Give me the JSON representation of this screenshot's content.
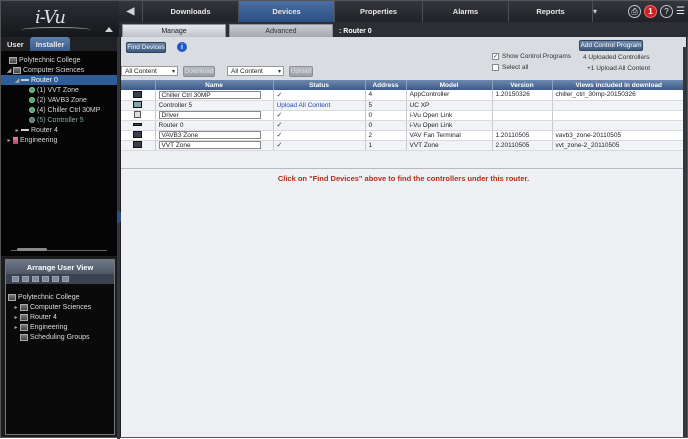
{
  "app": {
    "logo_text": "i-Vu"
  },
  "topnav": {
    "tabs": [
      {
        "label": "Downloads",
        "active": false
      },
      {
        "label": "Devices",
        "active": true
      },
      {
        "label": "Properties",
        "active": false
      },
      {
        "label": "Alarms",
        "active": false
      },
      {
        "label": "Reports",
        "active": false
      }
    ],
    "alarm_count": "1",
    "help_label": "?",
    "dropdown_glyph": "▾"
  },
  "subnav": {
    "tabs": [
      {
        "label": "Manage",
        "active": true
      },
      {
        "label": "Advanced",
        "active": false
      }
    ],
    "breadcrumb": ": Router 0"
  },
  "sidebar": {
    "tabs": [
      {
        "label": "User",
        "active": false
      },
      {
        "label": "Installer",
        "active": true
      }
    ],
    "tree": [
      {
        "label": "Polytechnic College",
        "icon": "building-icon"
      },
      {
        "label": "Computer Sciences",
        "icon": "building-icon"
      },
      {
        "label": "Router 0",
        "icon": "router-icon",
        "selected": true
      },
      {
        "label": "(1) VVT Zone",
        "icon": "controller-icon"
      },
      {
        "label": "(2) VAVB3 Zone",
        "icon": "controller-icon"
      },
      {
        "label": "(4) Chiller Ctrl 30MP",
        "icon": "controller-icon"
      },
      {
        "label": "(5) Controller 5",
        "icon": "controller-icon"
      },
      {
        "label": "Router 4",
        "icon": "router-icon"
      },
      {
        "label": "Engineering",
        "icon": "building-icon"
      }
    ]
  },
  "arrange_view": {
    "title": "Arrange User View",
    "items": [
      {
        "label": "Polytechnic College"
      },
      {
        "label": "Computer Sciences"
      },
      {
        "label": "Router 4"
      },
      {
        "label": "Engineering"
      },
      {
        "label": "Scheduling Groups"
      }
    ]
  },
  "toolbar": {
    "find_devices_label": "Find Devices",
    "info_label": "i",
    "content_select_1": "All Content",
    "download_label": "Download",
    "content_select_2": "All Content",
    "upload_label": "Upload",
    "show_control_programs": "Show Control Programs",
    "show_control_programs_checked": "✓",
    "select_all": "Select all",
    "add_control_program_label": "Add Control Program",
    "uploaded_controllers": "4  Uploaded Controllers",
    "upload_all_content": "+1 Upload All Content"
  },
  "table": {
    "columns": [
      "Name",
      "Status",
      "Address",
      "Model",
      "Version",
      "Views included in download"
    ],
    "rows": [
      {
        "icon": "controller-icon",
        "name": "Chiller Ctrl 30MP",
        "status": "✓",
        "address": "4",
        "model": "AppController",
        "version": "1.20150326",
        "views": "chiller_ctrl_30mp-20150326"
      },
      {
        "icon": "transmitter-icon",
        "name": "Controller 5",
        "status": "Upload All Content",
        "address": "5",
        "model": "UC XP",
        "version": "",
        "views": ""
      },
      {
        "icon": "driver-icon",
        "name": "Driver",
        "status": "✓",
        "address": "0",
        "model": "i-Vu Open Link",
        "version": "",
        "views": ""
      },
      {
        "icon": "router-icon",
        "name": "Router 0",
        "status": "✓",
        "address": "0",
        "model": "i-Vu Open Link",
        "version": "",
        "views": ""
      },
      {
        "icon": "controller-icon",
        "name": "VAVB3 Zone",
        "status": "✓",
        "address": "2",
        "model": "VAV Fan Terminal",
        "version": "1.20110505",
        "views": "vavb3_zone-20110505"
      },
      {
        "icon": "controller-icon",
        "name": "VVT Zone",
        "status": "✓",
        "address": "1",
        "model": "VVT Zone",
        "version": "2.20110505",
        "views": "vvt_zone-2_20110505"
      }
    ]
  },
  "message": "Click on \"Find Devices\" above to find the controllers under this router.",
  "colors": {
    "accent": "#3a5b8c",
    "alert": "#cc2222",
    "message": "#b52c1a"
  }
}
